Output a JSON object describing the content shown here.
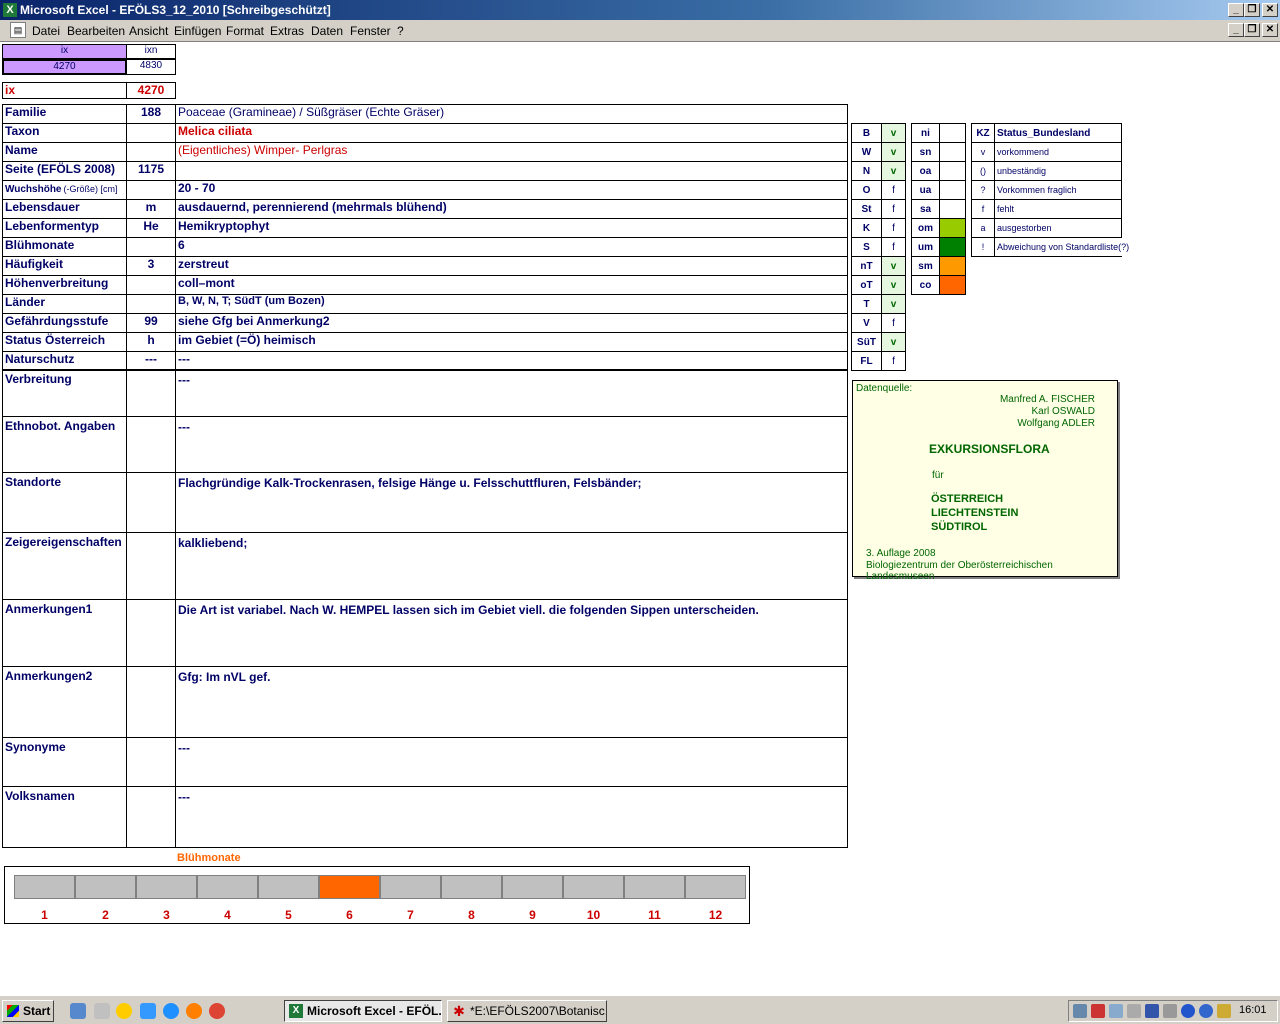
{
  "window": {
    "title": "Microsoft Excel - EFÖLS3_12_2010  [Schreibgeschützt]",
    "app_icon": "excel-icon",
    "controls": [
      "_",
      "❐",
      "✕"
    ]
  },
  "menu": {
    "items": [
      "Datei",
      "Bearbeiten",
      "Ansicht",
      "Einfügen",
      "Format",
      "Extras",
      "Daten",
      "Fenster",
      "?"
    ]
  },
  "index": {
    "ix_header": "ix",
    "ixn_header": "ixn",
    "ix_value": "4270",
    "ixn_value": "4830",
    "ix_label": "ix",
    "ix_big": "4270"
  },
  "rows": [
    {
      "label": "Familie",
      "num": "188",
      "value": "Poaceae (Gramineae)  /  Süßgräser (Echte Gräser)"
    },
    {
      "label": "Taxon",
      "num": "",
      "value": "Melica ciliata"
    },
    {
      "label": "Name",
      "num": "",
      "value": "(Eigentliches) Wimper- Perlgras"
    },
    {
      "label": "Seite (EFÖLS 2008)",
      "num": "1175",
      "value": ""
    },
    {
      "label": "Wuchshöhe",
      "label_suffix": "(-Größe) [cm]",
      "num": "",
      "value": " 20 - 70"
    },
    {
      "label": "Lebensdauer",
      "num": "m",
      "value": "ausdauernd, perennierend (mehrmals blühend)"
    },
    {
      "label": "Lebenformentyp",
      "num": "He",
      "value": "Hemikryptophyt"
    },
    {
      "label": "Blühmonate",
      "num": "",
      "value": " 6"
    },
    {
      "label": "Häufigkeit",
      "num": "3",
      "value": "zerstreut"
    },
    {
      "label": "Höhenverbreitung",
      "num": "",
      "value": "coll–mont"
    },
    {
      "label": "Länder",
      "num": "",
      "value": "B, W, N, T; SüdT (um Bozen)"
    },
    {
      "label": "Gefährdungsstufe",
      "num": "99",
      "value": "siehe Gfg bei Anmerkung2"
    },
    {
      "label": "Status Österreich",
      "num": "h",
      "value": "im Gebiet (=Ö) heimisch"
    },
    {
      "label": "Naturschutz",
      "num": "---",
      "value": " ---"
    }
  ],
  "big_rows": [
    {
      "label": "Verbreitung",
      "value": " ---"
    },
    {
      "label": "Ethnobot. Angaben",
      "value": "---"
    },
    {
      "label": "Standorte",
      "value": "Flachgründige Kalk-Trockenrasen, felsige Hänge u. Felsschuttfluren, Felsbänder;"
    },
    {
      "label": "Zeigereigenschaften",
      "value": "kalkliebend;"
    },
    {
      "label": "Anmerkungen1",
      "value": "Die Art ist variabel. Nach W. HEMPEL lassen sich im Gebiet viell. die folgenden Sippen unterscheiden."
    },
    {
      "label": "Anmerkungen2",
      "value": "Gfg:  Im nVL gef."
    },
    {
      "label": "Synonyme",
      "value": "---"
    },
    {
      "label": "Volksnamen",
      "value": "---"
    }
  ],
  "laender": [
    {
      "code": "B",
      "status": "v"
    },
    {
      "code": "W",
      "status": "v"
    },
    {
      "code": "N",
      "status": "v"
    },
    {
      "code": "O",
      "status": "f"
    },
    {
      "code": "St",
      "status": "f"
    },
    {
      "code": "K",
      "status": "f"
    },
    {
      "code": "S",
      "status": "f"
    },
    {
      "code": "nT",
      "status": "v"
    },
    {
      "code": "oT",
      "status": "v"
    },
    {
      "code": "T",
      "status": "v"
    },
    {
      "code": "V",
      "status": "f"
    },
    {
      "code": "SüT",
      "status": "v"
    },
    {
      "code": "FL",
      "status": "f"
    }
  ],
  "hoehen": [
    {
      "code": "ni",
      "color": ""
    },
    {
      "code": "sn",
      "color": ""
    },
    {
      "code": "oa",
      "color": ""
    },
    {
      "code": "ua",
      "color": ""
    },
    {
      "code": "sa",
      "color": ""
    },
    {
      "code": "om",
      "color": "#99cc00"
    },
    {
      "code": "um",
      "color": "#008000"
    },
    {
      "code": "sm",
      "color": "#ff9900"
    },
    {
      "code": "co",
      "color": "#ff6600"
    }
  ],
  "legend": {
    "kz_header": "KZ",
    "status_header": "Status_Bundesland",
    "items": [
      {
        "kz": "v",
        "text": "vorkommend"
      },
      {
        "kz": "()",
        "text": "unbeständig"
      },
      {
        "kz": "?",
        "text": "Vorkommen fraglich"
      },
      {
        "kz": "f",
        "text": "fehlt"
      },
      {
        "kz": "a",
        "text": "ausgestorben"
      },
      {
        "kz": "!",
        "text": "Abweichung von Standardliste(?)"
      }
    ]
  },
  "datenquelle": {
    "label": "Datenquelle:",
    "authors": [
      "Manfred A. FISCHER",
      "Karl OSWALD",
      "Wolfgang ADLER"
    ],
    "title": "EXKURSIONSFLORA",
    "fuer": "für",
    "countries": [
      "ÖSTERREICH",
      "LIECHTENSTEIN",
      "SÜDTIROL"
    ],
    "edition": "3. Auflage 2008",
    "publisher": "Biologiezentrum der Oberösterreichischen Landesmuseen"
  },
  "bluehmonate_chart": {
    "title": "Blühmonate",
    "months": [
      "1",
      "2",
      "3",
      "4",
      "5",
      "6",
      "7",
      "8",
      "9",
      "10",
      "11",
      "12"
    ],
    "active": [
      6
    ],
    "active_color": "#ff6600",
    "inactive_color": "#c0c0c0"
  },
  "taskbar": {
    "start_label": "Start",
    "tasks": [
      "Microsoft Excel - EFÖL...",
      "*E:\\EFÖLS2007\\Botanisc..."
    ],
    "clock": "16:01"
  }
}
